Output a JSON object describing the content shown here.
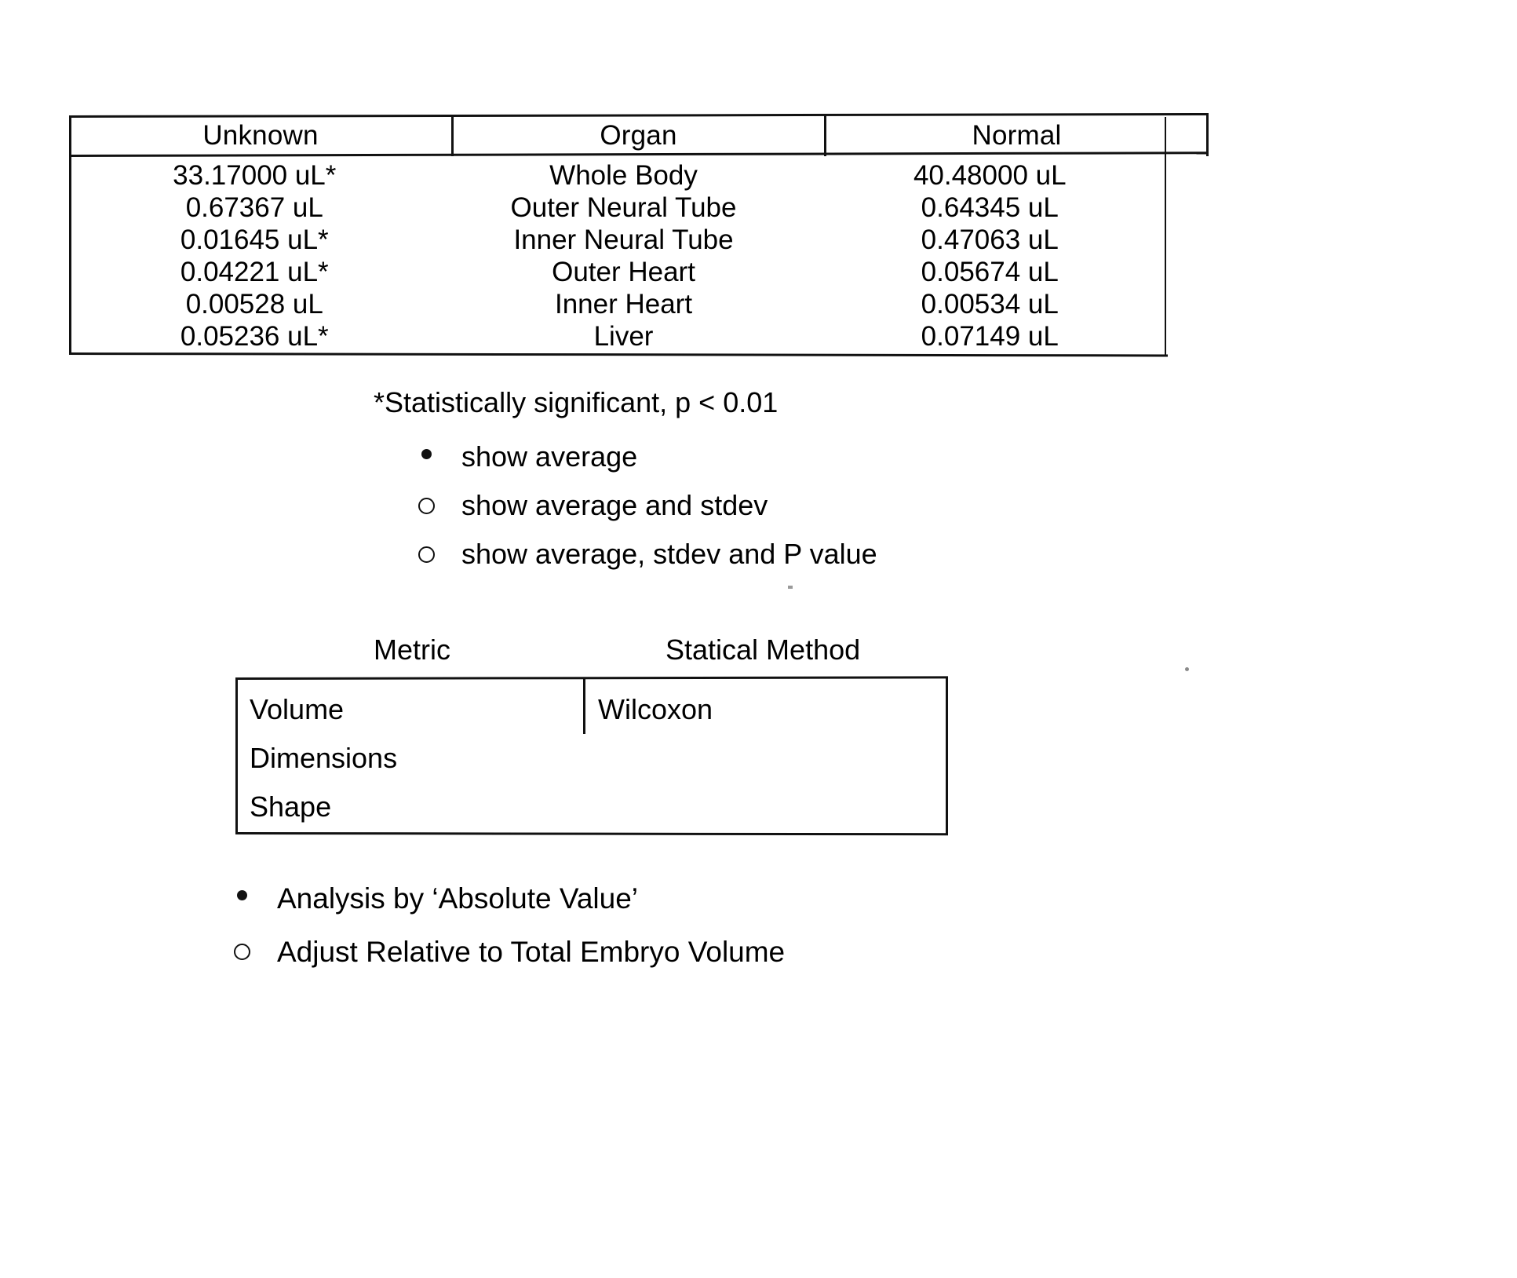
{
  "results_table": {
    "columns": [
      "Unknown",
      "Organ",
      "Normal"
    ],
    "rows": [
      {
        "unknown": "33.17000 uL*",
        "organ": "Whole Body",
        "normal": "40.48000 uL"
      },
      {
        "unknown": "0.67367 uL",
        "organ": "Outer Neural Tube",
        "normal": "0.64345 uL"
      },
      {
        "unknown": "0.01645 uL*",
        "organ": "Inner Neural Tube",
        "normal": "0.47063 uL"
      },
      {
        "unknown": "0.04221 uL*",
        "organ": "Outer Heart",
        "normal": "0.05674 uL"
      },
      {
        "unknown": "0.00528 uL",
        "organ": "Inner Heart",
        "normal": "0.00534 uL"
      },
      {
        "unknown": "0.05236 uL*",
        "organ": "Liver",
        "normal": "0.07149 uL"
      }
    ]
  },
  "footnote": "*Statistically significant, p < 0.01",
  "display_options": [
    {
      "label": "show average",
      "marker": "bullet-filled-icon",
      "selected": true
    },
    {
      "label": "show average and stdev",
      "marker": "bullet-hollow-icon",
      "selected": false
    },
    {
      "label": "show average, stdev and P value",
      "marker": "bullet-hollow-icon",
      "selected": false
    }
  ],
  "metric_table": {
    "headers": {
      "metric": "Metric",
      "method": "Statical Method"
    },
    "metrics": [
      "Volume",
      "Dimensions",
      "Shape"
    ],
    "methods": [
      "Wilcoxon"
    ]
  },
  "analysis_options": [
    {
      "label": "Analysis by ‘Absolute Value’",
      "marker": "bullet-filled-icon",
      "selected": true
    },
    {
      "label": "Adjust Relative to Total Embryo Volume",
      "marker": "bullet-hollow-icon",
      "selected": false
    }
  ],
  "colors": {
    "ink": "#111111",
    "paper": "#ffffff"
  }
}
